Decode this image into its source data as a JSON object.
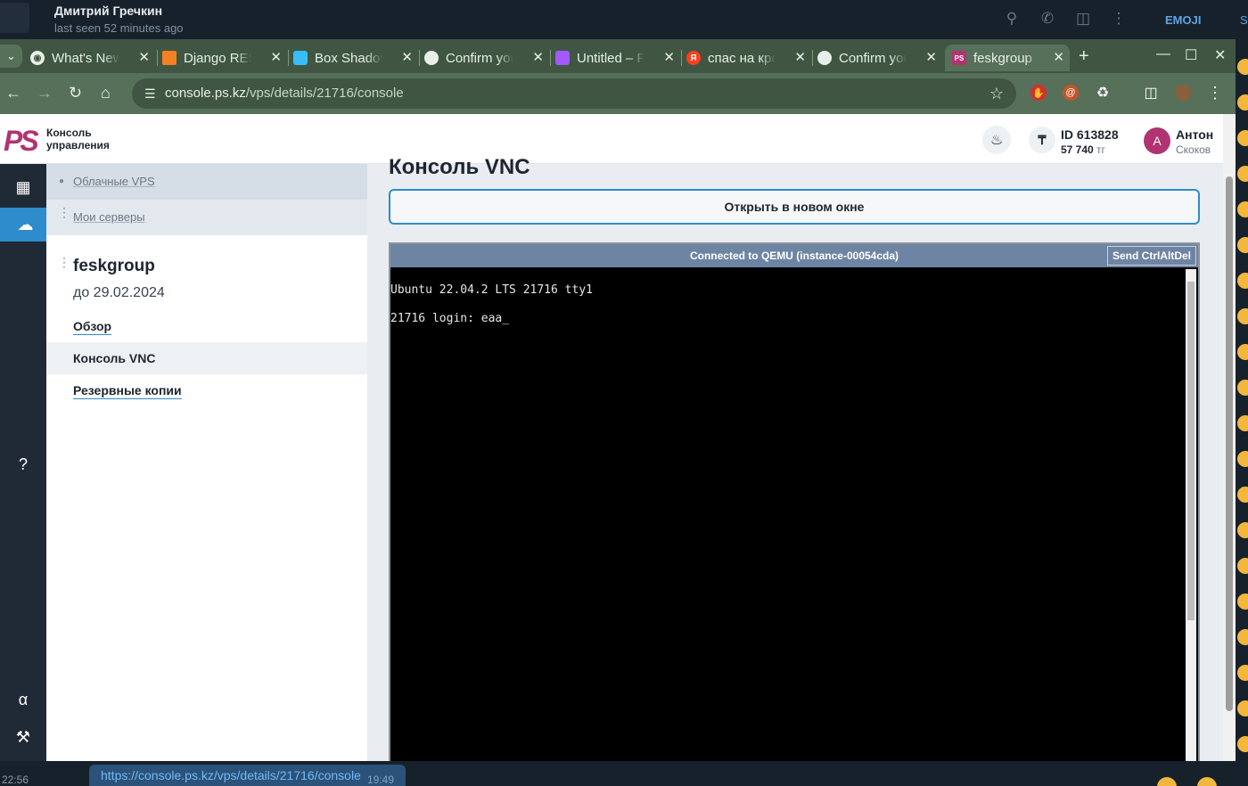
{
  "telegram": {
    "contact_name": "Дмитрий Гречкин",
    "last_seen": "last seen 52 minutes ago",
    "emoji_tab": "EMOJI",
    "second_tab": "S",
    "left_time": "22:56",
    "link_preview": "https://console.ps.kz/vps/details/21716/console",
    "message_time": "19:49"
  },
  "browser": {
    "tabs": [
      {
        "title": "What's New",
        "favicon": "chrome-icon"
      },
      {
        "title": "Django REST",
        "favicon": "stackoverflow-icon"
      },
      {
        "title": "Box Shadow",
        "favicon": "tailwind-icon"
      },
      {
        "title": "Confirm your",
        "favicon": "github-icon"
      },
      {
        "title": "Untitled – F",
        "favicon": "figma-icon"
      },
      {
        "title": "спас на кро",
        "favicon": "yandex-icon"
      },
      {
        "title": "Confirm your",
        "favicon": "github-icon"
      },
      {
        "title": "feskgroup",
        "favicon": "ps-icon"
      }
    ],
    "url_host": "console.ps.kz",
    "url_path": "/vps/details/21716/console"
  },
  "site": {
    "logo_text": "PS",
    "logo_line1": "Консоль",
    "logo_line2": "управления",
    "account_id": "ID 613828",
    "balance_amount": "57 740",
    "balance_currency": "тг",
    "avatar_letter": "А",
    "user_first": "Антон",
    "user_last": "Скоков"
  },
  "sidebar": {
    "breadcrumb1": "Облачные VPS",
    "breadcrumb2": "Мои серверы",
    "server_name": "feskgroup",
    "server_until": "до 29.02.2024",
    "links": {
      "overview": "Обзор",
      "vnc": "Консоль VNC",
      "backups": "Резервные копии"
    }
  },
  "main": {
    "title": "Консоль VNC",
    "open_button": "Открыть в новом окне",
    "vnc_status": "Connected to QEMU (instance-00054cda)",
    "send_cad": "Send CtrlAltDel",
    "terminal_lines": [
      "Ubuntu 22.04.2 LTS 21716 tty1",
      "21716 login: eaa_"
    ]
  },
  "colors": {
    "brand": "#b23371",
    "accent": "#2e8ccd",
    "browser_frame": "#405642"
  }
}
